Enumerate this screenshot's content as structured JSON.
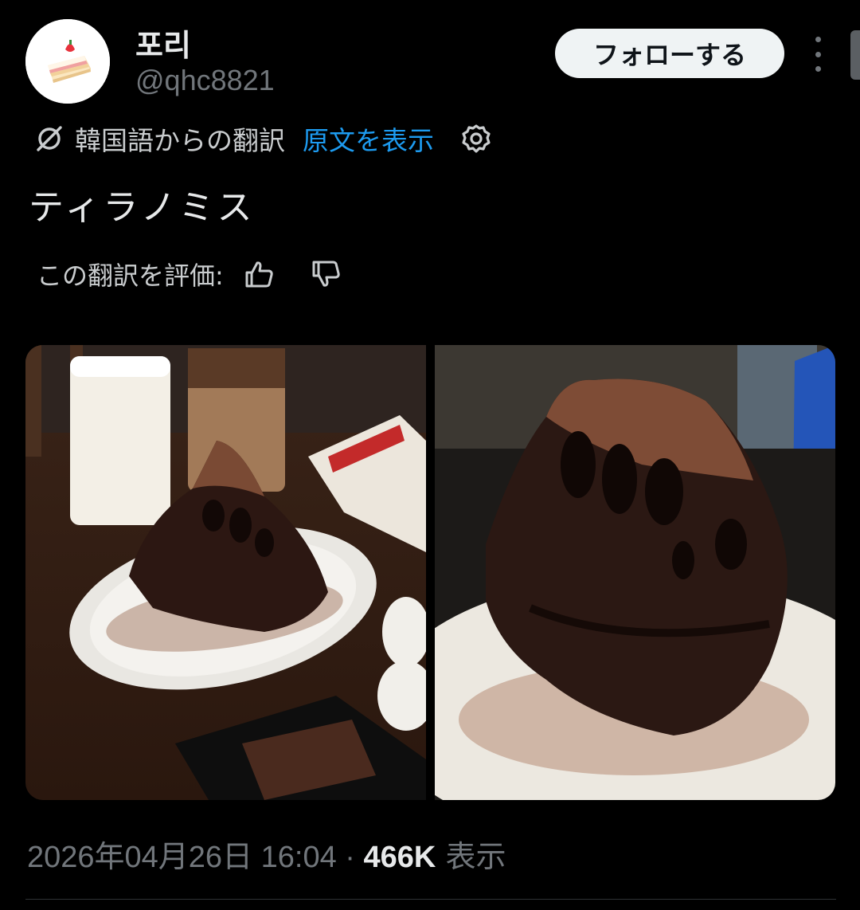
{
  "author": {
    "display_name": "포리",
    "handle": "@qhc8821",
    "avatar_icon": "strawberry-shortcake-icon"
  },
  "header": {
    "follow_label": "フォローする",
    "more_icon": "more-vertical-icon"
  },
  "translation": {
    "translated_from": "韓国語からの翻訳",
    "show_original": "原文を表示",
    "settings_icon": "gear-icon"
  },
  "tweet": {
    "text": "ティラノミス"
  },
  "rating": {
    "label": "この翻訳を評価:",
    "thumbs_up_icon": "thumbs-up-icon",
    "thumbs_down_icon": "thumbs-down-icon"
  },
  "media": [
    {
      "name": "tiramisu-table-photo"
    },
    {
      "name": "tiramisu-closeup-photo"
    }
  ],
  "meta": {
    "timestamp": "2026年04月26日 16:04",
    "separator": " · ",
    "views": "466K",
    "views_label": " 表示"
  },
  "colors": {
    "background": "#000000",
    "accent": "#1d9bf0",
    "primary_text": "#e7e9ea",
    "secondary_text": "#71767b"
  }
}
